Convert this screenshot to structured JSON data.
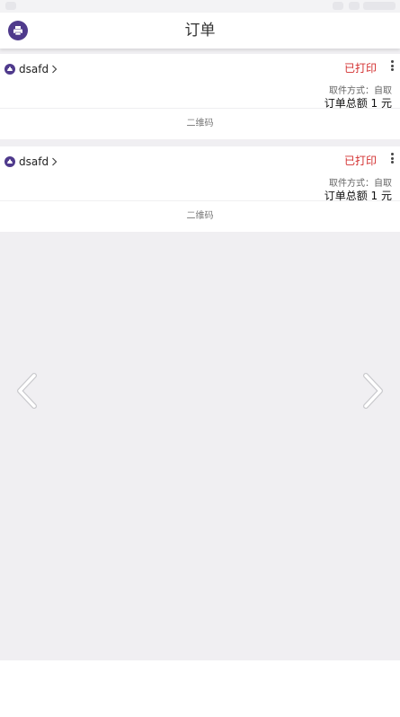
{
  "header": {
    "title": "订单",
    "app_icon": "printer-icon"
  },
  "orders": [
    {
      "store_name": "dsafd",
      "status": "已打印",
      "pickup": "取件方式：自取",
      "total": "订单总额 1 元",
      "qr_label": "二维码"
    },
    {
      "store_name": "dsafd",
      "status": "已打印",
      "pickup": "取件方式：自取",
      "total": "订单总额 1 元",
      "qr_label": "二维码"
    }
  ],
  "navigation": {
    "prev_icon": "chevron-left-icon",
    "next_icon": "chevron-right-icon"
  },
  "colors": {
    "brand": "#4f3a8c",
    "status_red": "#d32f2f",
    "background": "#f0eff2"
  }
}
